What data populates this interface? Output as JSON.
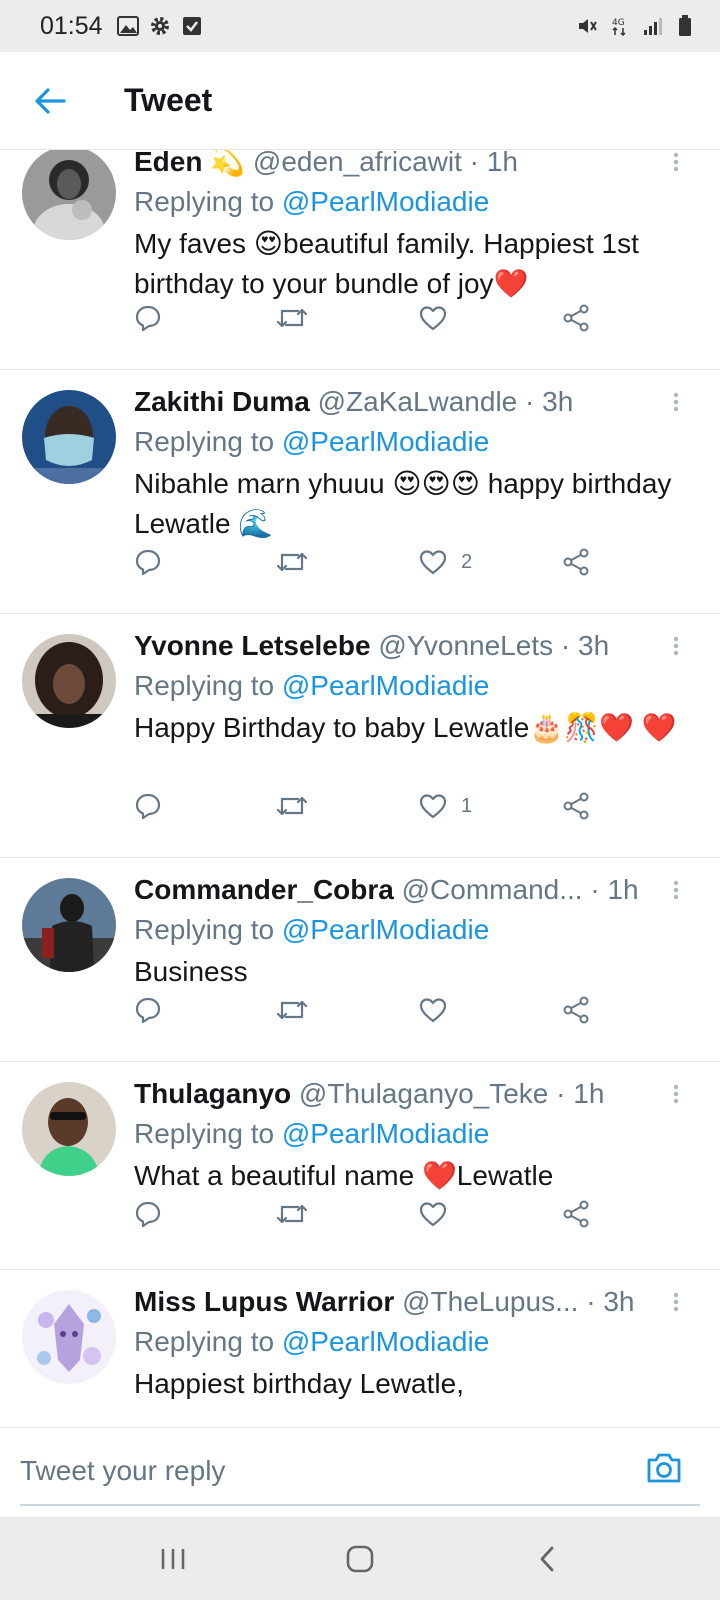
{
  "status_bar": {
    "time": "01:54",
    "network": "4G"
  },
  "header": {
    "title": "Tweet"
  },
  "colors": {
    "accent": "#1b95e0",
    "secondary_text": "#657786",
    "divider": "#e1e8ed"
  },
  "tweets": [
    {
      "name": "Eden",
      "handle": "@eden_africawit",
      "time": "1h",
      "replying_prefix": "Replying to",
      "replying_to": "@PearlModiadie",
      "text": "My faves 😍beautiful family. Happiest 1st birthday to your bundle of joy❤️",
      "name_emoji": "💫",
      "likes": ""
    },
    {
      "name": "Zakithi Duma",
      "handle": "@ZaKaLwandle",
      "time": "3h",
      "replying_prefix": "Replying to",
      "replying_to": "@PearlModiadie",
      "text": "Nibahle marn yhuuu  😍😍😍 happy birthday Lewatle 🌊",
      "likes": "2"
    },
    {
      "name": "Yvonne Letselebe",
      "handle": "@YvonneLets",
      "time": "3h",
      "replying_prefix": "Replying to",
      "replying_to": "@PearlModiadie",
      "text": "Happy Birthday to baby Lewatle🎂🎊❤️ ❤️",
      "likes": "1"
    },
    {
      "name": "Commander_Cobra",
      "handle": "@Command...",
      "time": "1h",
      "replying_prefix": "Replying to",
      "replying_to": "@PearlModiadie",
      "text": "Business",
      "likes": ""
    },
    {
      "name": "Thulaganyo",
      "handle": "@Thulaganyo_Teke",
      "time": "1h",
      "replying_prefix": "Replying to",
      "replying_to": "@PearlModiadie",
      "text": "What a beautiful name ❤️Lewatle",
      "likes": ""
    },
    {
      "name": "Miss Lupus Warrior",
      "handle": "@TheLupus...",
      "time": "3h",
      "replying_prefix": "Replying to",
      "replying_to": "@PearlModiadie",
      "text": "Happiest birthday Lewatle,",
      "likes": ""
    }
  ],
  "composer": {
    "placeholder": "Tweet your reply"
  },
  "icons": {
    "reply": "reply-icon",
    "retweet": "retweet-icon",
    "like": "heart-icon",
    "share": "share-icon",
    "more": "more-vertical-icon",
    "back": "back-arrow-icon",
    "camera": "camera-icon"
  }
}
